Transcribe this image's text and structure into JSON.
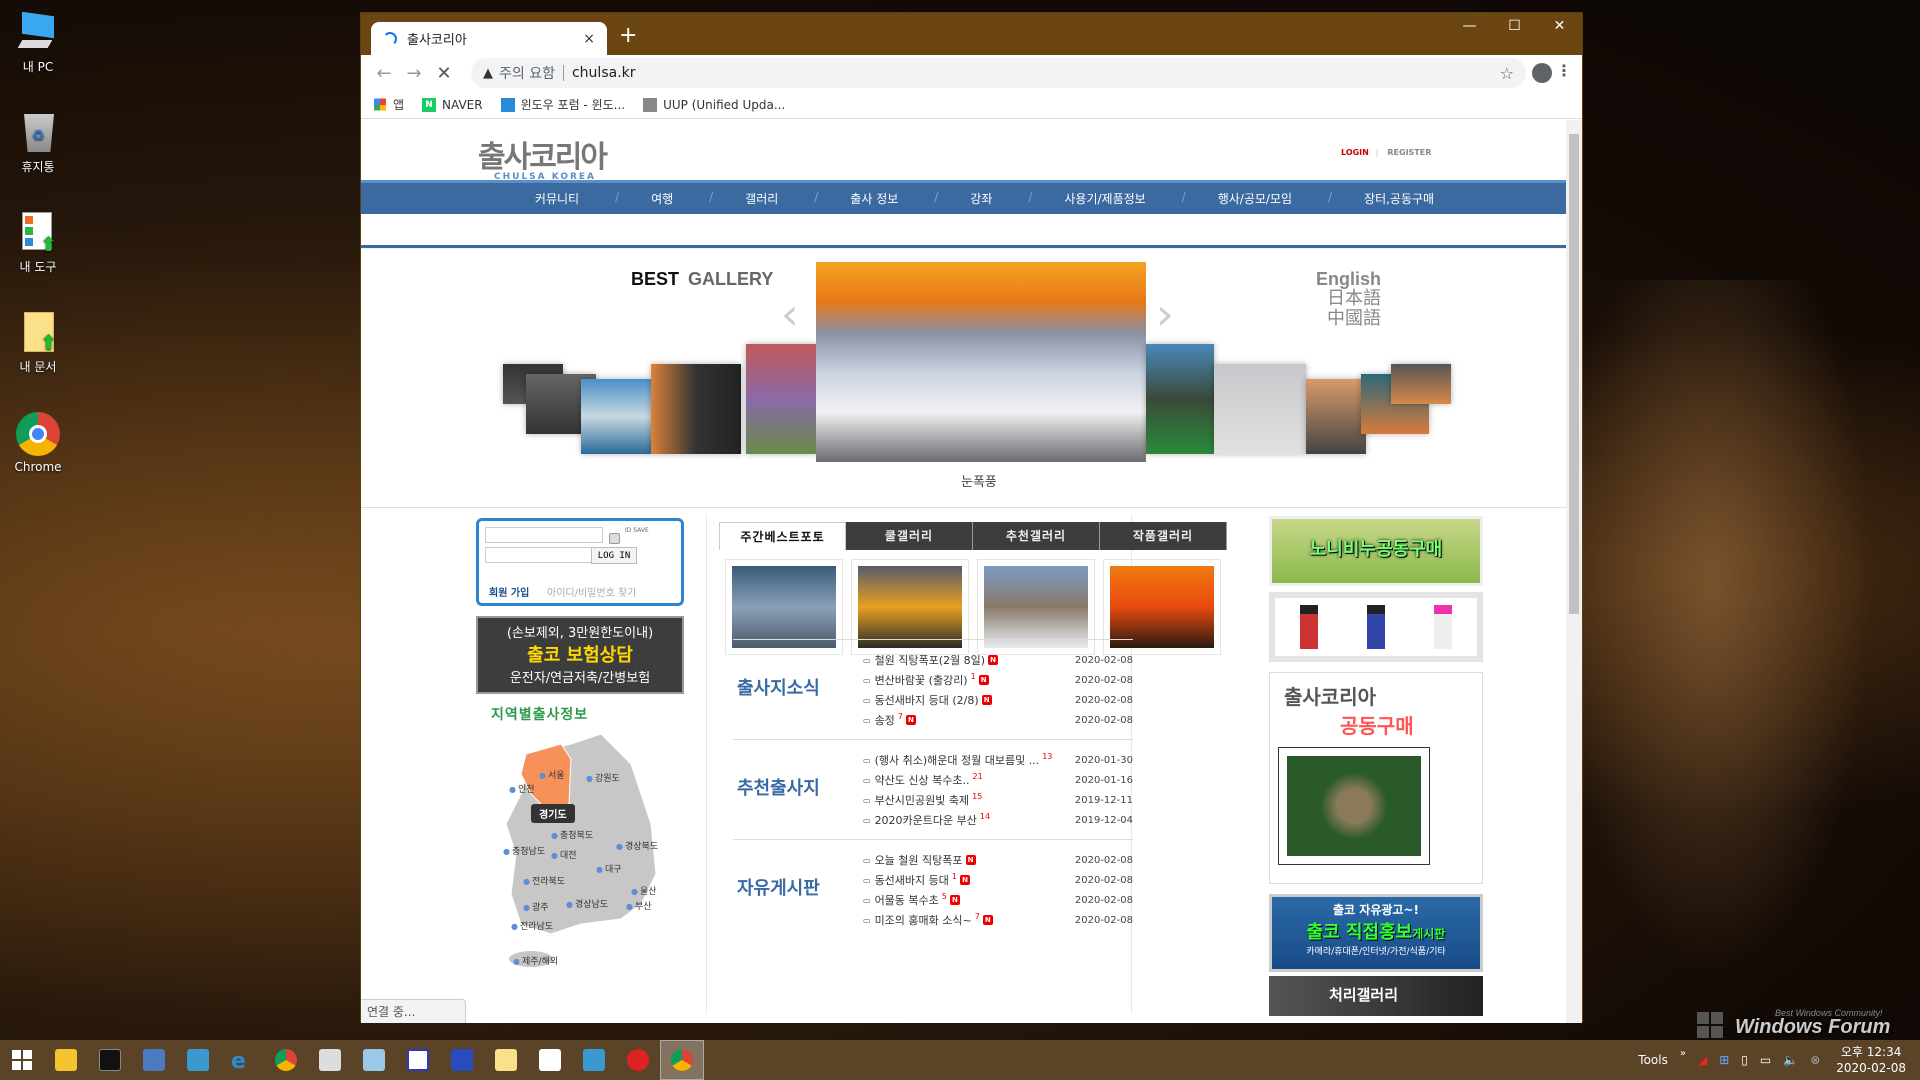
{
  "desktop": {
    "icons": [
      {
        "label": "내 PC",
        "icon": "computer-icon"
      },
      {
        "label": "휴지통",
        "icon": "recycle-bin-icon"
      },
      {
        "label": "내 도구",
        "icon": "tools-shortcut-icon"
      },
      {
        "label": "내 문서",
        "icon": "documents-shortcut-icon"
      },
      {
        "label": "Chrome",
        "icon": "chrome-icon"
      }
    ],
    "watermark": {
      "title": "Windows Forum",
      "subtitle": "Best Windows Community!"
    }
  },
  "browser": {
    "tab_title": "출사코리아",
    "new_tab": "+",
    "tab_close": "×",
    "address": {
      "warning": "주의 요함",
      "url": "chulsa.kr"
    },
    "bookmarks": [
      {
        "label": "앱",
        "icon": "apps-grid-icon"
      },
      {
        "label": "NAVER",
        "icon": "naver-icon"
      },
      {
        "label": "윈도우 포럼 - 윈도...",
        "icon": "windows-logo-icon"
      },
      {
        "label": "UUP (Unified Upda...",
        "icon": "uup-icon"
      }
    ],
    "status": "연결 중..."
  },
  "site": {
    "logo": {
      "main": "출사코리아",
      "sub": "CHULSA KOREA"
    },
    "auth": {
      "login": "LOGIN",
      "register": "REGISTER"
    },
    "nav": [
      "커뮤니티",
      "여행",
      "갤러리",
      "출사 정보",
      "강좌",
      "사용기/제품정보",
      "행사/공모/모임",
      "장터,공동구매"
    ],
    "gallery": {
      "title_bold": "BEST",
      "title_rest": "GALLERY",
      "caption": "눈폭풍",
      "languages": [
        "English",
        "日本語",
        "中國語"
      ]
    },
    "login_box": {
      "id_save": "ID SAVE",
      "login_button": "LOG IN",
      "join": "회원 가입",
      "find": "아이디/비밀번호 찾기"
    },
    "insurance_banner": {
      "line1": "(손보제외, 3만원한도이내)",
      "line2": "출코 보험상담",
      "line3": "운전자/연금저축/간병보험"
    },
    "region": {
      "title": "지역별출사정보",
      "highlight": "경기도",
      "labels": [
        "서울",
        "인천",
        "강원도",
        "충청북도",
        "충청남도",
        "대전",
        "경상북도",
        "대구",
        "전라북도",
        "울산",
        "광주",
        "경상남도",
        "부산",
        "전라남도",
        "제주/해외"
      ]
    },
    "photo_tabs": [
      "주간베스트포토",
      "쿨갤러리",
      "추천갤러리",
      "작품갤러리"
    ],
    "boards": [
      {
        "title": "출사지소식",
        "posts": [
          {
            "title": "철원 직탕폭포(2월 8일)",
            "count": "",
            "new": true,
            "date": "2020-02-08"
          },
          {
            "title": "변산바람꽃 (출강리)",
            "count": "1",
            "new": true,
            "date": "2020-02-08"
          },
          {
            "title": "동선새바지 등대 (2/8)",
            "count": "",
            "new": true,
            "date": "2020-02-08"
          },
          {
            "title": "송정",
            "count": "7",
            "new": true,
            "date": "2020-02-08"
          }
        ]
      },
      {
        "title": "추천출사지",
        "posts": [
          {
            "title": "(행사 취소)해운대 정월 대보름및 ...",
            "count": "13",
            "new": false,
            "date": "2020-01-30"
          },
          {
            "title": "약산도 신상 복수초..",
            "count": "21",
            "new": false,
            "date": "2020-01-16"
          },
          {
            "title": "부산시민공원빛 축제",
            "count": "15",
            "new": false,
            "date": "2019-12-11"
          },
          {
            "title": "2020카운트다운 부산",
            "count": "14",
            "new": false,
            "date": "2019-12-04"
          }
        ]
      },
      {
        "title": "자유게시판",
        "posts": [
          {
            "title": "오늘 철원 직탕폭포",
            "count": "",
            "new": true,
            "date": "2020-02-08"
          },
          {
            "title": "동선새바지 등대",
            "count": "1",
            "new": true,
            "date": "2020-02-08"
          },
          {
            "title": "어물동 복수초",
            "count": "5",
            "new": true,
            "date": "2020-02-08"
          },
          {
            "title": "미조의 홍매화 소식~",
            "count": "7",
            "new": true,
            "date": "2020-02-08"
          }
        ]
      }
    ],
    "new_badge": "N",
    "ads": {
      "noni": "노니비누공동구매",
      "chulsa_group_main": "출사코리아",
      "chulsa_group_sub": "공동구매",
      "promo_l1": "출코 자유광고~!",
      "promo_l2": "출코 직접홍보",
      "promo_l2b": "게시판",
      "promo_l3": "카메라/휴대폰/인터넷/가전/식품/기타",
      "cheori": "처리갤러리"
    }
  },
  "taskbar": {
    "tools_label": "Tools",
    "chevron": "»",
    "time": "오후 12:34",
    "date": "2020-02-08"
  }
}
